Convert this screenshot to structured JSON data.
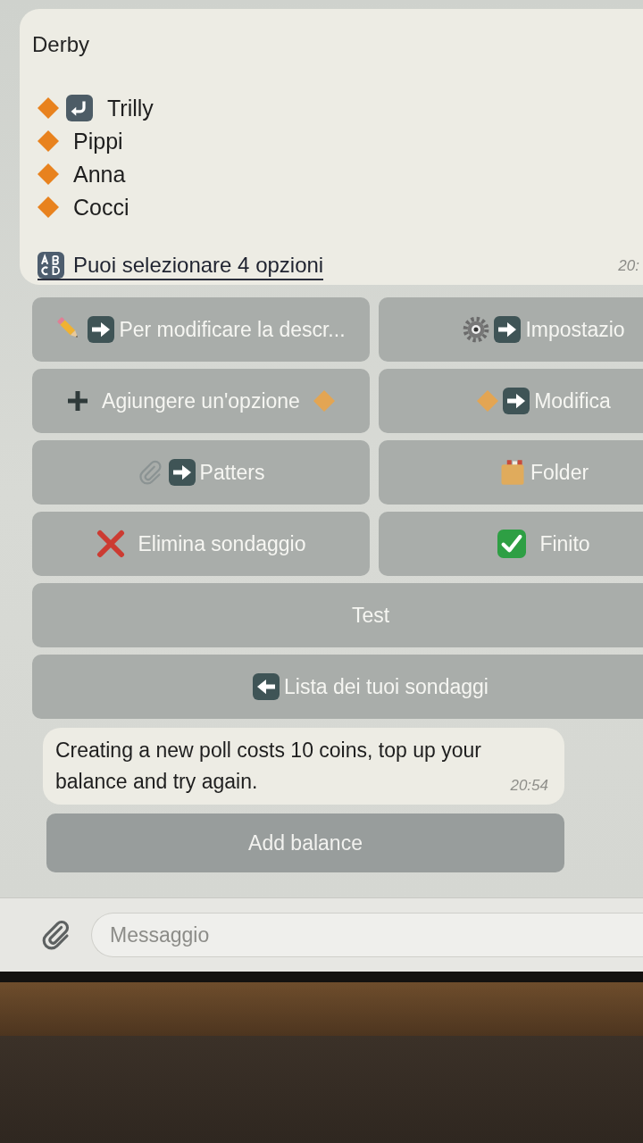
{
  "poll_message": {
    "title": "Derby",
    "options": [
      {
        "label": "Trilly",
        "selected": true
      },
      {
        "label": "Pippi",
        "selected": false
      },
      {
        "label": "Anna",
        "selected": false
      },
      {
        "label": "Cocci",
        "selected": false
      }
    ],
    "link": "Puoi selezionare 4 opzioni",
    "time": "20:"
  },
  "keyboard": [
    {
      "label": "Per modificare la descr...",
      "kind": "describe",
      "wide": false
    },
    {
      "label": "Impostazio",
      "kind": "settings",
      "wide": false
    },
    {
      "label": "Agiungere un'opzione",
      "kind": "add",
      "wide": false
    },
    {
      "label": "Modifica",
      "kind": "modify",
      "wide": false
    },
    {
      "label": "Patters",
      "kind": "patterns",
      "wide": false
    },
    {
      "label": "Folder",
      "kind": "folder",
      "wide": false
    },
    {
      "label": "Elimina sondaggio",
      "kind": "delete",
      "wide": false
    },
    {
      "label": "Finito",
      "kind": "done",
      "wide": false
    },
    {
      "label": "Test",
      "kind": "plain",
      "wide": true
    },
    {
      "label": "Lista dei tuoi sondaggi",
      "kind": "back",
      "wide": true
    }
  ],
  "reply_message": {
    "text": "Creating a new poll costs 10 coins, top up your balance and try again.",
    "time": "20:54"
  },
  "reply_button": {
    "label": "Add balance"
  },
  "composer": {
    "placeholder": "Messaggio"
  }
}
